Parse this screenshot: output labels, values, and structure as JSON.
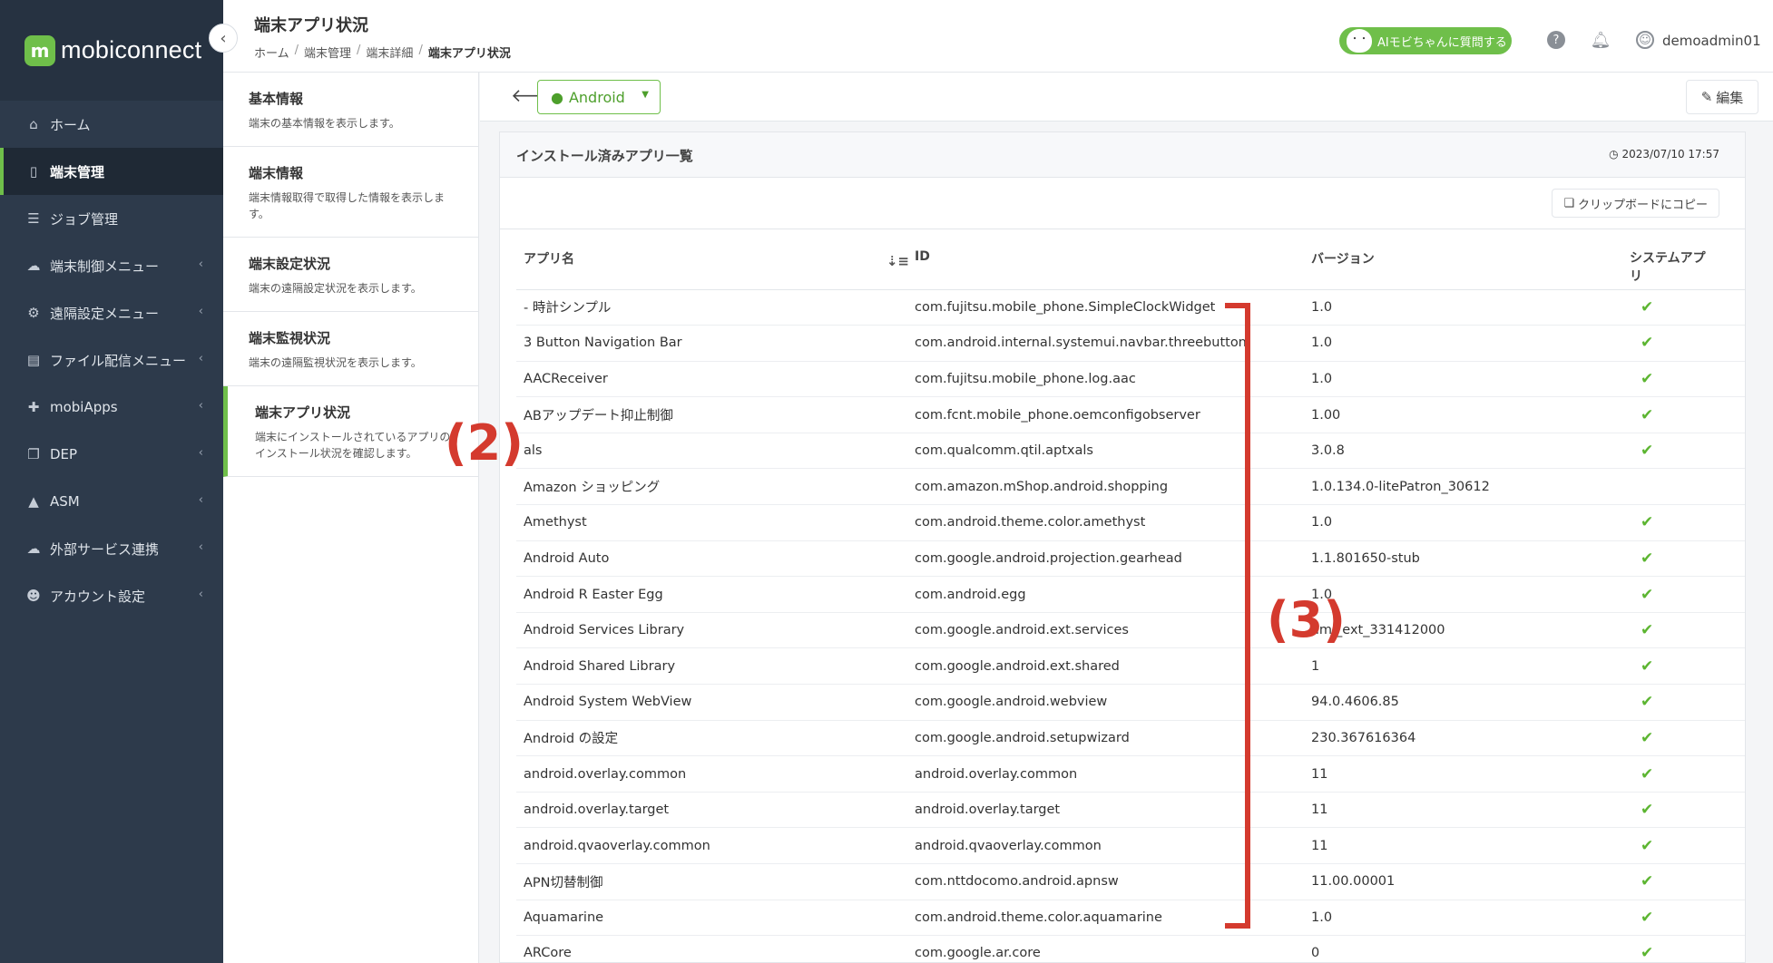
{
  "brand": {
    "logo_letter": "m",
    "name": "mobiconnect"
  },
  "sidebar": {
    "items": [
      {
        "label": "ホーム",
        "icon": "home-icon",
        "glyph": "⌂",
        "active": false,
        "chevron": false
      },
      {
        "label": "端末管理",
        "icon": "tablet-icon",
        "glyph": "▯",
        "active": true,
        "chevron": false
      },
      {
        "label": "ジョブ管理",
        "icon": "server-icon",
        "glyph": "☰",
        "active": false,
        "chevron": false
      },
      {
        "label": "端末制御メニュー",
        "icon": "cloud-icon",
        "glyph": "☁",
        "active": false,
        "chevron": true
      },
      {
        "label": "遠隔設定メニュー",
        "icon": "cogs-icon",
        "glyph": "⚙",
        "active": false,
        "chevron": true
      },
      {
        "label": "ファイル配信メニュー",
        "icon": "file-icon",
        "glyph": "▤",
        "active": false,
        "chevron": true
      },
      {
        "label": "mobiApps",
        "icon": "puzzle-icon",
        "glyph": "✚",
        "active": false,
        "chevron": true
      },
      {
        "label": "DEP",
        "icon": "copy-icon",
        "glyph": "❐",
        "active": false,
        "chevron": true
      },
      {
        "label": "ASM",
        "icon": "graduation-cap-icon",
        "glyph": "▲",
        "active": false,
        "chevron": true
      },
      {
        "label": "外部サービス連携",
        "icon": "cloud-icon",
        "glyph": "☁",
        "active": false,
        "chevron": true
      },
      {
        "label": "アカウント設定",
        "icon": "users-icon",
        "glyph": "☻",
        "active": false,
        "chevron": true
      }
    ]
  },
  "header": {
    "title": "端末アプリ状況",
    "breadcrumb": [
      "ホーム",
      "端末管理",
      "端末詳細",
      "端末アプリ状況"
    ],
    "ai_button": "AIモビちゃんに質問する",
    "ai_face": "・・",
    "user": "demoadmin01"
  },
  "subnav": {
    "items": [
      {
        "title": "基本情報",
        "desc": "端末の基本情報を表示します。",
        "active": false
      },
      {
        "title": "端末情報",
        "desc": "端末情報取得で取得した情報を表示します。",
        "active": false
      },
      {
        "title": "端末設定状況",
        "desc": "端末の遠隔設定状況を表示します。",
        "active": false
      },
      {
        "title": "端末監視状況",
        "desc": "端末の遠隔監視状況を表示します。",
        "active": false
      },
      {
        "title": "端末アプリ状況",
        "desc": "端末にインストールされているアプリのインストール状況を確認します。",
        "active": true
      }
    ]
  },
  "toolbar": {
    "os": "Android",
    "edit": "編集"
  },
  "panel": {
    "title": "インストール済みアプリ一覧",
    "timestamp": "2023/07/10 17:57",
    "copy_button": "クリップボードにコピー",
    "columns": [
      "アプリ名",
      "ID",
      "バージョン",
      "システムアプリ"
    ],
    "rows": [
      {
        "name": "- 時計シンプル",
        "id": "com.fujitsu.mobile_phone.SimpleClockWidget",
        "version": "1.0",
        "system": true
      },
      {
        "name": "3 Button Navigation Bar",
        "id": "com.android.internal.systemui.navbar.threebutton",
        "version": "1.0",
        "system": true
      },
      {
        "name": "AACReceiver",
        "id": "com.fujitsu.mobile_phone.log.aac",
        "version": "1.0",
        "system": true
      },
      {
        "name": "ABアップデート抑止制御",
        "id": "com.fcnt.mobile_phone.oemconfigobserver",
        "version": "1.00",
        "system": true
      },
      {
        "name": "als",
        "id": "com.qualcomm.qtil.aptxals",
        "version": "3.0.8",
        "system": true
      },
      {
        "name": "Amazon ショッピング",
        "id": "com.amazon.mShop.android.shopping",
        "version": "1.0.134.0-litePatron_30612",
        "system": false
      },
      {
        "name": "Amethyst",
        "id": "com.android.theme.color.amethyst",
        "version": "1.0",
        "system": true
      },
      {
        "name": "Android Auto",
        "id": "com.google.android.projection.gearhead",
        "version": "1.1.801650-stub",
        "system": true
      },
      {
        "name": "Android R Easter Egg",
        "id": "com.android.egg",
        "version": "1.0",
        "system": true
      },
      {
        "name": "Android Services Library",
        "id": "com.google.android.ext.services",
        "version": "aml_ext_331412000",
        "system": true
      },
      {
        "name": "Android Shared Library",
        "id": "com.google.android.ext.shared",
        "version": "1",
        "system": true
      },
      {
        "name": "Android System WebView",
        "id": "com.google.android.webview",
        "version": "94.0.4606.85",
        "system": true
      },
      {
        "name": "Android の設定",
        "id": "com.google.android.setupwizard",
        "version": "230.367616364",
        "system": true
      },
      {
        "name": "android.overlay.common",
        "id": "android.overlay.common",
        "version": "11",
        "system": true
      },
      {
        "name": "android.overlay.target",
        "id": "android.overlay.target",
        "version": "11",
        "system": true
      },
      {
        "name": "android.qvaoverlay.common",
        "id": "android.qvaoverlay.common",
        "version": "11",
        "system": true
      },
      {
        "name": "APN切替制御",
        "id": "com.nttdocomo.android.apnsw",
        "version": "11.00.00001",
        "system": true
      },
      {
        "name": "Aquamarine",
        "id": "com.android.theme.color.aquamarine",
        "version": "1.0",
        "system": true
      },
      {
        "name": "ARCore",
        "id": "com.google.ar.core",
        "version": "0",
        "system": true
      }
    ]
  },
  "annotations": {
    "label_2": "(2)",
    "label_3": "(3)"
  },
  "colors": {
    "accent": "#6fbf4a",
    "sidebar": "#2d3a4b",
    "annotation": "#d43a2e",
    "check": "#5cb531"
  }
}
